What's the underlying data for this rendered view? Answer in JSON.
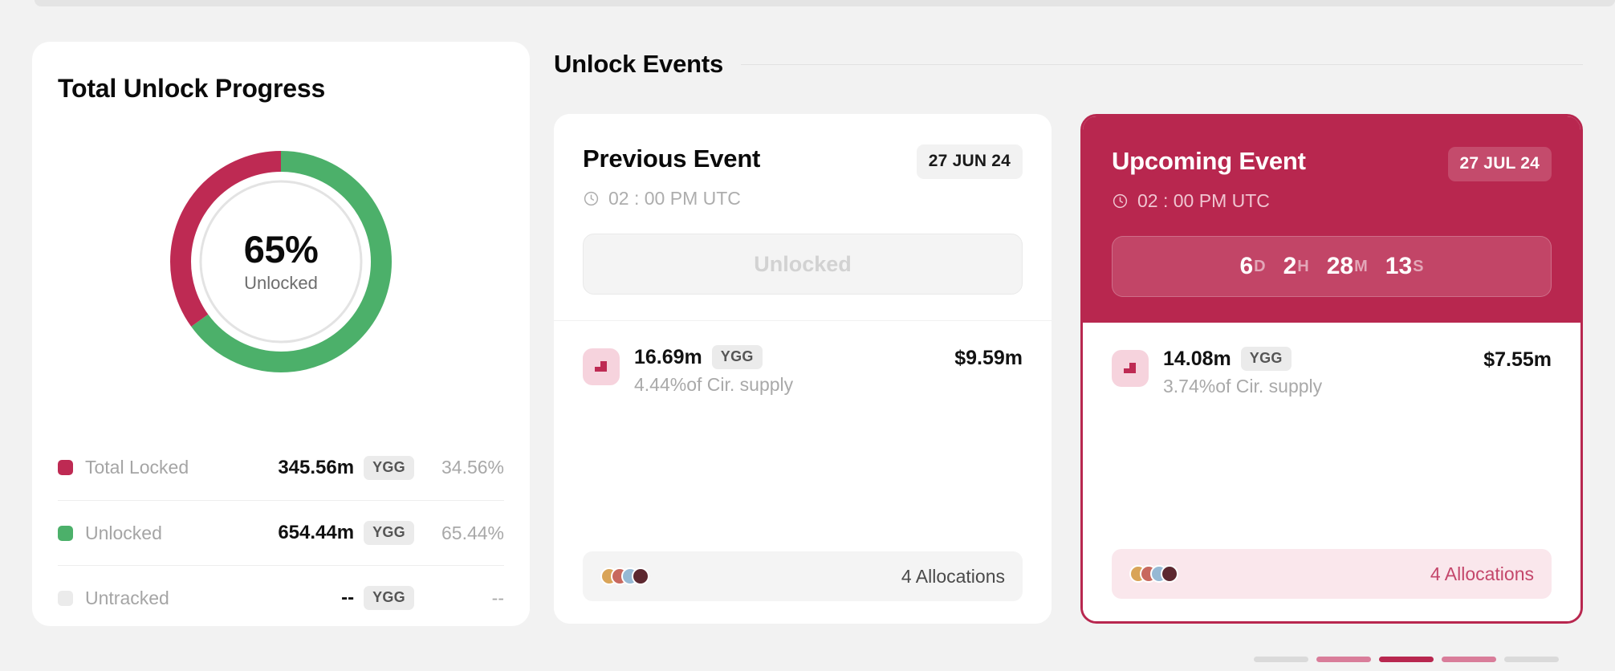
{
  "left_panel": {
    "title": "Total Unlock Progress",
    "donut": {
      "center_value": "65%",
      "center_label": "Unlocked",
      "unlocked_pct": 65,
      "locked_pct": 35,
      "locked_color": "#be2a53",
      "unlocked_color": "#4cb06a",
      "track_color": "#e3e3e3"
    },
    "legend": [
      {
        "label": "Total Locked",
        "amount": "345.56m",
        "token": "YGG",
        "percent": "34.56%",
        "color": "#be2a53"
      },
      {
        "label": "Unlocked",
        "amount": "654.44m",
        "token": "YGG",
        "percent": "65.44%",
        "color": "#4cb06a"
      },
      {
        "label": "Untracked",
        "amount": "--",
        "token": "YGG",
        "percent": "--",
        "color": "#ebebeb"
      }
    ]
  },
  "events_section": {
    "title": "Unlock Events",
    "cards": [
      {
        "kind": "previous",
        "title": "Previous Event",
        "date_badge": "27 JUN 24",
        "time": "02 : 00 PM UTC",
        "status_label": "Unlocked",
        "amount": "16.69m",
        "token": "YGG",
        "supply_note": "4.44%of Cir. supply",
        "usd_value": "$9.59m",
        "allocations_label": "4 Allocations",
        "avatar_colors": [
          "#d9a458",
          "#c8685e",
          "#96b9d4",
          "#5d2830"
        ]
      },
      {
        "kind": "upcoming",
        "title": "Upcoming Event",
        "date_badge": "27 JUL 24",
        "time": "02 : 00 PM UTC",
        "countdown": {
          "days": "6",
          "days_unit": "D",
          "hours": "2",
          "hours_unit": "H",
          "minutes": "28",
          "minutes_unit": "M",
          "seconds": "13",
          "seconds_unit": "S"
        },
        "amount": "14.08m",
        "token": "YGG",
        "supply_note": "3.74%of Cir. supply",
        "usd_value": "$7.55m",
        "allocations_label": "4 Allocations",
        "avatar_colors": [
          "#d9a458",
          "#c8685e",
          "#96b9d4",
          "#5d2830"
        ]
      }
    ]
  },
  "pagination": {
    "bars": [
      "inactive",
      "mid",
      "active",
      "mid",
      "inactive"
    ]
  },
  "colors": {
    "brand_crimson": "#b8274f",
    "green": "#4cb06a",
    "pink_soft": "#fae7ec"
  }
}
